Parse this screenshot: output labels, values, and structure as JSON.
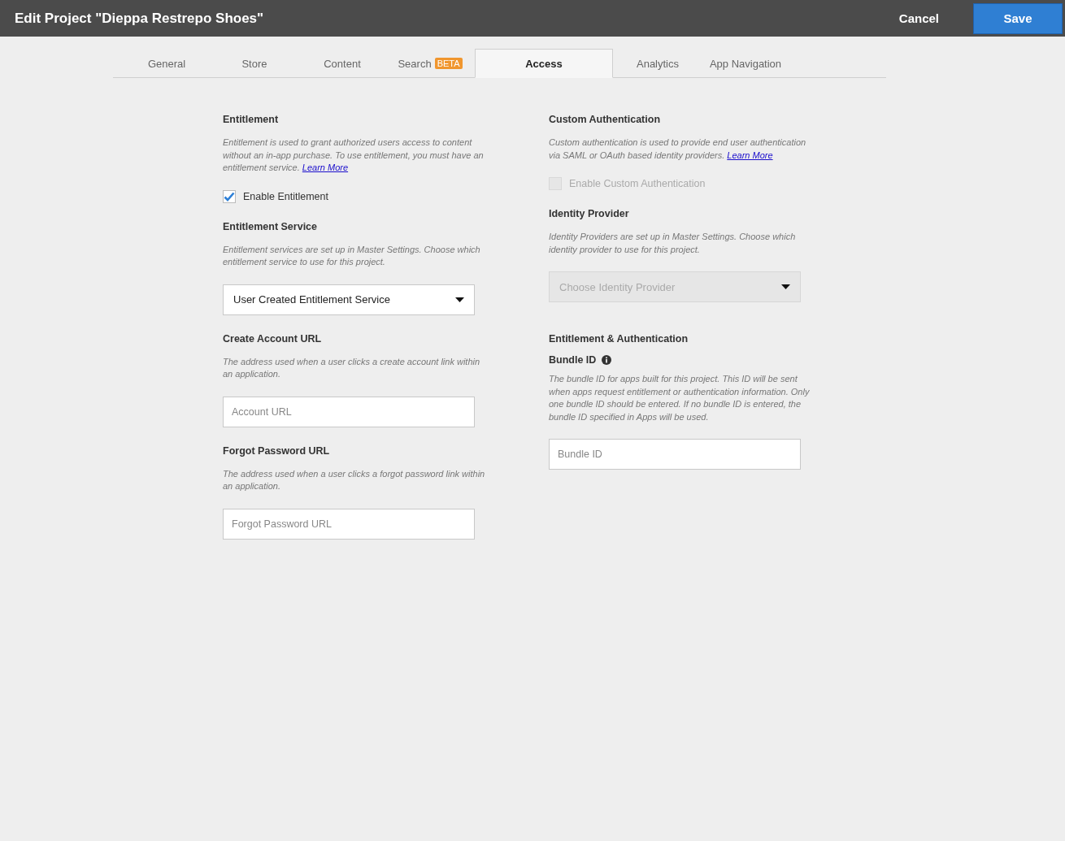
{
  "header": {
    "title": "Edit Project \"Dieppa Restrepo Shoes\"",
    "cancel": "Cancel",
    "save": "Save"
  },
  "tabs": [
    {
      "label": "General",
      "selected": false
    },
    {
      "label": "Store",
      "selected": false
    },
    {
      "label": "Content",
      "selected": false
    },
    {
      "label": "Search",
      "badge": "BETA",
      "selected": false
    },
    {
      "label": "Access",
      "selected": true
    },
    {
      "label": "Analytics",
      "selected": false
    },
    {
      "label": "App Navigation",
      "selected": false
    }
  ],
  "columns": [
    {
      "blocks": [
        {
          "kind": "heading",
          "text": "Entitlement"
        },
        {
          "kind": "description",
          "text": "Entitlement is used to grant authorized users access to content without an  in-app purchase. To use  entitlement, you must have an entitlement service. ",
          "link": "Learn More"
        },
        {
          "kind": "checkbox",
          "label": "Enable Entitlement",
          "checked": true,
          "disabled": false
        },
        {
          "kind": "heading",
          "text": "Entitlement Service"
        },
        {
          "kind": "description",
          "text": "Entitlement services are set up in Master Settings. Choose which entitlement service to use for this  project."
        },
        {
          "kind": "dropdown",
          "value": "User Created Entitlement Service",
          "disabled": false
        },
        {
          "kind": "heading",
          "text": "Create Account URL"
        },
        {
          "kind": "description",
          "text": "The address used when a user clicks a create account link within an application."
        },
        {
          "kind": "textfield",
          "placeholder": "Account URL"
        },
        {
          "kind": "heading",
          "text": "Forgot Password URL"
        },
        {
          "kind": "description",
          "text": "The address used when a user clicks a forgot password link within an application."
        },
        {
          "kind": "textfield",
          "placeholder": "Forgot Password URL"
        }
      ]
    },
    {
      "blocks": [
        {
          "kind": "heading",
          "text": "Custom Authentication"
        },
        {
          "kind": "description",
          "text": "Custom authentication is used to provide end user authentication via SAML or OAuth based identity providers. ",
          "link": "Learn More"
        },
        {
          "kind": "checkbox",
          "label": "Enable Custom Authentication",
          "checked": false,
          "disabled": true
        },
        {
          "kind": "heading",
          "text": "Identity Provider"
        },
        {
          "kind": "description",
          "text": "Identity Providers are set up in Master Settings.  Choose which identity provider to use for this project."
        },
        {
          "kind": "dropdown",
          "placeholder": "Choose Identity Provider",
          "disabled": true
        },
        {
          "kind": "heading",
          "text": "Entitlement & Authentication"
        },
        {
          "kind": "subheading",
          "text": "Bundle ID",
          "info": true
        },
        {
          "kind": "description",
          "text": "The bundle ID for apps built for this project. This ID will be sent when apps request entitlement or authentication information. Only one bundle ID should be entered. If no bundle ID is entered, the bundle ID specified in Apps will be used."
        },
        {
          "kind": "textfield",
          "placeholder": "Bundle ID"
        }
      ]
    }
  ]
}
